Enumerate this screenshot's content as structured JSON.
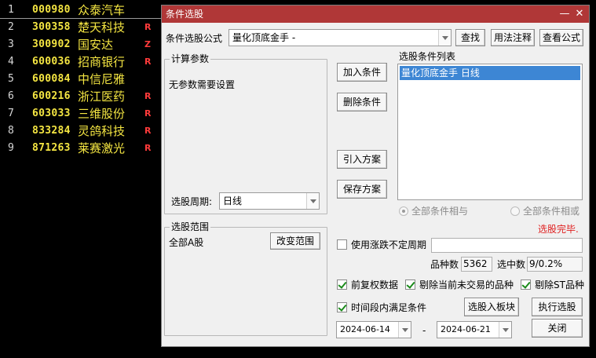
{
  "stock_list": [
    {
      "idx": "1",
      "code": "000980",
      "name": "众泰汽车",
      "flag": ""
    },
    {
      "idx": "2",
      "code": "300358",
      "name": "楚天科技",
      "flag": "R"
    },
    {
      "idx": "3",
      "code": "300902",
      "name": "国安达",
      "flag": "Z"
    },
    {
      "idx": "4",
      "code": "600036",
      "name": "招商银行",
      "flag": "R"
    },
    {
      "idx": "5",
      "code": "600084",
      "name": "中信尼雅",
      "flag": ""
    },
    {
      "idx": "6",
      "code": "600216",
      "name": "浙江医药",
      "flag": "R"
    },
    {
      "idx": "7",
      "code": "603033",
      "name": "三维股份",
      "flag": "R"
    },
    {
      "idx": "8",
      "code": "833284",
      "name": "灵鸽科技",
      "flag": "R"
    },
    {
      "idx": "9",
      "code": "871263",
      "name": "莱赛激光",
      "flag": "R"
    }
  ],
  "dialog": {
    "title": "条件选股",
    "minimize_glyph": "—",
    "close_glyph": "✕",
    "formula_label": "条件选股公式",
    "formula_value": "量化顶底金手 -",
    "search_button": "查找",
    "usage_button": "用法注释",
    "view_formula_button": "查看公式",
    "params_group": "计算参数",
    "params_text": "无参数需要设置",
    "period_label": "选股周期:",
    "period_value": "日线",
    "add_condition_button": "加入条件",
    "delete_condition_button": "删除条件",
    "import_plan_button": "引入方案",
    "save_plan_button": "保存方案",
    "conditions_list_label": "选股条件列表",
    "conditions": [
      "量化顶底金手  日线"
    ],
    "radio_and_label": "全部条件相与",
    "radio_or_label": "全部条件相或",
    "status_text": "选股完毕.",
    "range_group": "选股范围",
    "range_value": "全部A股",
    "change_range_button": "改变范围",
    "use_period_label": "使用涨跌不定周期",
    "count_label": "品种数",
    "count_value": "5362",
    "selected_label": "选中数",
    "selected_value": "9/0.2%",
    "adjusted_label": "前复权数据",
    "exclude_untraded_label": "剔除当前未交易的品种",
    "exclude_st_label": "剔除ST品种",
    "time_range_label": "时间段内满足条件",
    "select_to_board_button": "选股入板块",
    "run_select_button": "执行选股",
    "start_date": "2024-06-14",
    "date_sep": "-",
    "end_date": "2024-06-21",
    "close_button": "关闭"
  }
}
